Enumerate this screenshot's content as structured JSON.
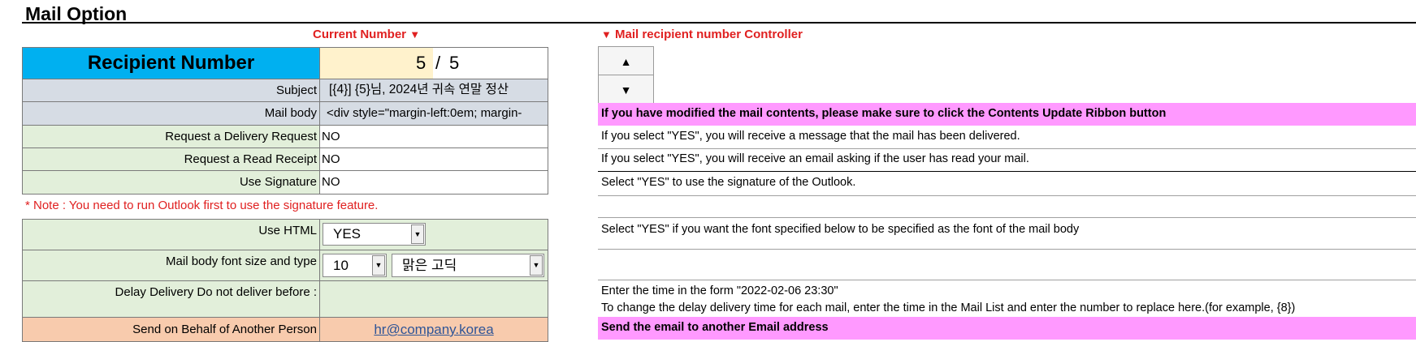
{
  "title": "Mail Option",
  "labels": {
    "current_number": "Current Number",
    "controller": "Mail recipient number Controller"
  },
  "recipient": {
    "label": "Recipient Number",
    "current": "5",
    "separator": "/",
    "total": "5"
  },
  "rows": {
    "subject": {
      "label": "Subject",
      "value": "[{4}] {5}님, 2024년 귀속 연말 정산"
    },
    "mail_body": {
      "label": "Mail body",
      "value": "<div style=\"margin-left:0em; margin-"
    },
    "delivery": {
      "label": "Request a Delivery Request",
      "value": "NO"
    },
    "read_receipt": {
      "label": "Request a Read Receipt",
      "value": "NO"
    },
    "signature": {
      "label": "Use Signature",
      "value": "NO"
    },
    "use_html": {
      "label": "Use HTML",
      "value": "YES"
    },
    "font": {
      "label": "Mail body font size and type",
      "size": "10",
      "face": "맑은 고딕"
    },
    "delay": {
      "label": "Delay Delivery Do not deliver before :",
      "value": ""
    },
    "behalf": {
      "label": "Send on Behalf of Another Person",
      "value": "hr@company.korea"
    }
  },
  "note": "* Note : You need to run Outlook first to use the signature feature.",
  "descriptions": {
    "modified": "If you have modified the mail contents, please make sure to click the Contents Update Ribbon button",
    "delivery": "If you select \"YES\", you will receive a message that the mail has been delivered.",
    "read": "If you select \"YES\", you will receive an email asking if the user has read your mail.",
    "signature": "Select \"YES\" to use the signature of the Outlook.",
    "html": "Select \"YES\" if you want the font specified below to be specified as the font of the mail body",
    "delay1": "Enter the time in the form \"2022-02-06 23:30\"",
    "delay2": "To change the delay delivery time for each mail, enter the time in the Mail List and enter the number to replace here.(for example, {8})",
    "behalf": "Send the email to another Email address"
  },
  "icons": {
    "up": "▲",
    "down": "▼",
    "marker": "▼",
    "dropdown": "▼"
  },
  "colors": {
    "header_blue": "#00b0f0",
    "pink_highlight": "#ff99ff",
    "red_text": "#e02020"
  }
}
